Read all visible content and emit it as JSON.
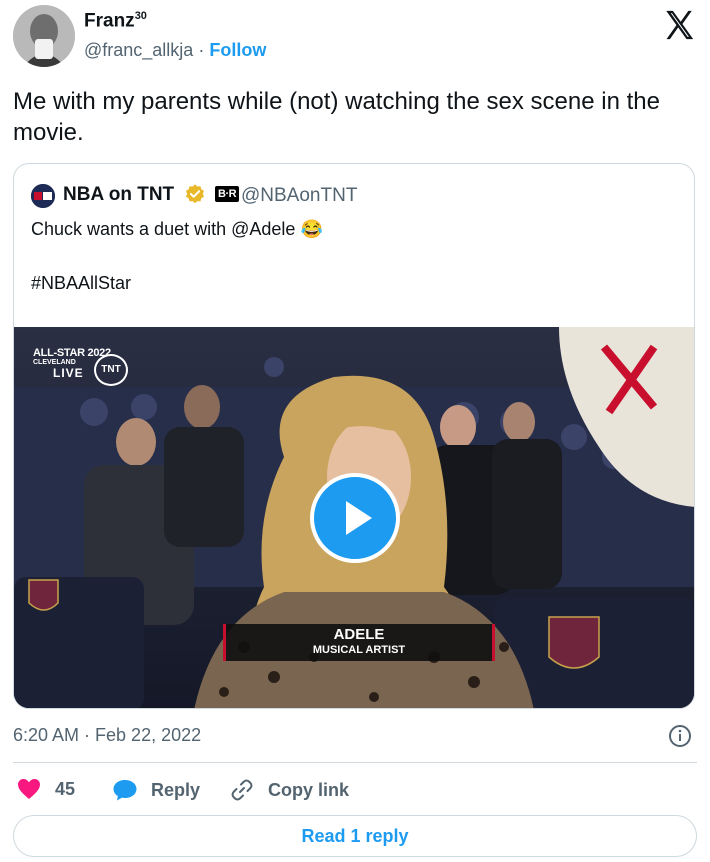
{
  "author": {
    "name": "Franz",
    "name_superscript": "30",
    "handle": "@franc_allkja",
    "separator": "·",
    "follow_label": "Follow"
  },
  "tweet": {
    "text": "Me with my parents while (not) watching the sex scene in the movie."
  },
  "quoted_tweet": {
    "name": "NBA on TNT",
    "badge_label": "B·R",
    "handle": "@NBAonTNT",
    "line1": "Chuck wants a duet with @Adele",
    "emoji": "😂",
    "line2": "#NBAAllStar",
    "video": {
      "overlay_title": "ALL-STAR 2022",
      "overlay_subtitle": "CLEVELAND",
      "overlay_live": "LIVE",
      "network_logo": "TNT",
      "lower_third_name": "ADELE",
      "lower_third_title": "MUSICAL ARTIST",
      "seat_logo": "CAVALIERS"
    }
  },
  "meta": {
    "timestamp": "6:20 AM · Feb 22, 2022"
  },
  "actions": {
    "like_count": "45",
    "reply_label": "Reply",
    "copy_link_label": "Copy link",
    "read_reply_label": "Read 1 reply"
  },
  "icons": {
    "like": "heart-icon",
    "reply": "speech-bubble-icon",
    "copy": "link-icon",
    "info": "info-icon",
    "platform": "x-logo-icon",
    "play": "play-icon",
    "verified": "verified-badge-icon"
  },
  "colors": {
    "accent": "#1d9bf0",
    "like": "#f91880",
    "text_secondary": "#536471",
    "border": "#cfd9de",
    "verified_gold": "#e8b829"
  }
}
